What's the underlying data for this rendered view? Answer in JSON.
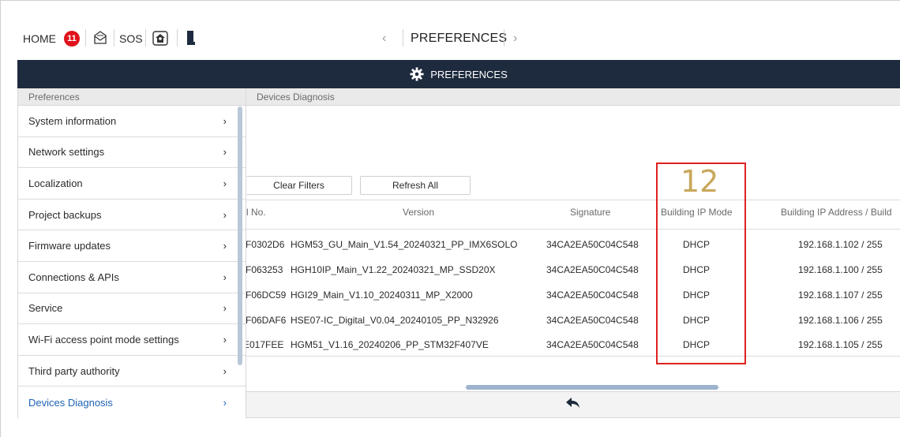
{
  "topbar": {
    "home_label": "HOME",
    "notification_count": "11",
    "sos_label": "SOS",
    "title": "PREFERENCES",
    "prev_chevron": "‹",
    "next_chevron": "›"
  },
  "header": {
    "title": "PREFERENCES"
  },
  "sidebar": {
    "heading": "Preferences",
    "items": [
      {
        "label": "System information"
      },
      {
        "label": "Network settings"
      },
      {
        "label": "Localization"
      },
      {
        "label": "Project backups"
      },
      {
        "label": "Firmware updates"
      },
      {
        "label": "Connections & APIs"
      },
      {
        "label": "Service"
      },
      {
        "label": "Wi-Fi access point mode settings"
      },
      {
        "label": "Third party authority"
      },
      {
        "label": "Devices Diagnosis"
      }
    ],
    "active_index": 9
  },
  "content": {
    "heading": "Devices Diagnosis",
    "clear_filters_label": "Clear Filters",
    "refresh_all_label": "Refresh All",
    "columns": [
      "l No.",
      "Version",
      "Signature",
      "Building IP Mode",
      "Building IP Address / Build"
    ],
    "rows": [
      {
        "serial": "F0302D6",
        "version": "HGM53_GU_Main_V1.54_20240321_PP_IMX6SOLO",
        "signature": "34CA2EA50C04C548",
        "ip_mode": "DHCP",
        "ip_address": "192.168.1.102 / 255"
      },
      {
        "serial": "F063253",
        "version": "HGH10IP_Main_V1.22_20240321_MP_SSD20X",
        "signature": "34CA2EA50C04C548",
        "ip_mode": "DHCP",
        "ip_address": "192.168.1.100 / 255"
      },
      {
        "serial": "F06DC59",
        "version": "HGI29_Main_V1.10_20240311_MP_X2000",
        "signature": "34CA2EA50C04C548",
        "ip_mode": "DHCP",
        "ip_address": "192.168.1.107 / 255"
      },
      {
        "serial": "F06DAF6",
        "version": "HSE07-IC_Digital_V0.04_20240105_PP_N32926",
        "signature": "34CA2EA50C04C548",
        "ip_mode": "DHCP",
        "ip_address": "192.168.1.106 / 255"
      },
      {
        "serial": "E017FEE",
        "version": "HGM51_V1.16_20240206_PP_STM32F407VE",
        "signature": "34CA2EA50C04C548",
        "ip_mode": "DHCP",
        "ip_address": "192.168.1.105 / 255"
      }
    ]
  },
  "annotation": {
    "callout_number": "12"
  },
  "colors": {
    "header_bg": "#1e2b3e",
    "accent_blue": "#1e63b5",
    "badge_red": "#e0121c",
    "highlight_red": "#e02020",
    "callout_gold": "#c9a85c"
  },
  "icons": {
    "notifications": "bell-badge",
    "messages": "envelope-icon",
    "home_security": "house-shield-icon",
    "door": "door-icon",
    "gear": "gear-icon",
    "back": "back-arrow-icon"
  }
}
